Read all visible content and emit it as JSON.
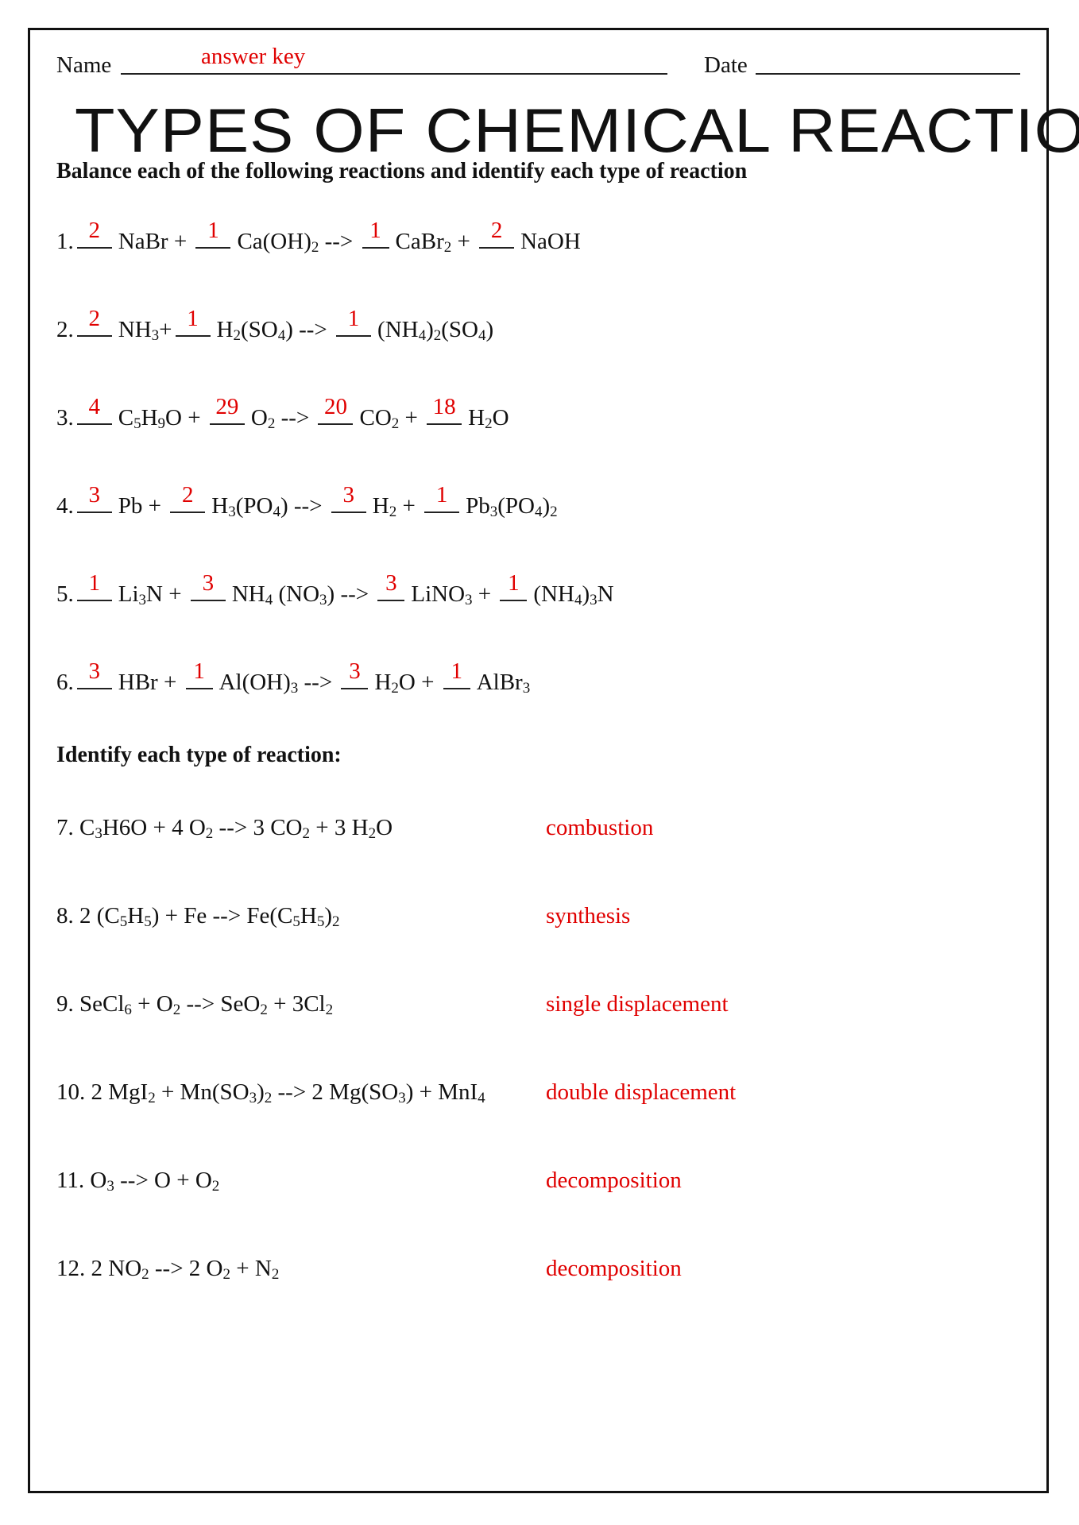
{
  "header": {
    "name_label": "Name",
    "name_value": "answer key",
    "date_label": "Date",
    "date_value": ""
  },
  "title": "TYPES OF CHEMICAL REACTIONS",
  "section1": {
    "instruction": "Balance each of the following reactions and identify each type of reaction",
    "problems": [
      {
        "number": "1.",
        "terms": [
          {
            "coef": "2",
            "formula": "NaBr",
            "blank": "w4"
          },
          {
            "op": "+"
          },
          {
            "coef": "1",
            "formula": "Ca(OH)_2",
            "blank": "w4"
          },
          {
            "op": "-->"
          },
          {
            "coef": "1",
            "formula": "CaBr_2",
            "blank": "w3"
          },
          {
            "op": "+"
          },
          {
            "coef": "2",
            "formula": "NaOH",
            "blank": "w4"
          }
        ]
      },
      {
        "number": "2.",
        "terms": [
          {
            "coef": "2",
            "formula": "NH_3+",
            "blank": "w4"
          },
          {
            "coef": "1",
            "formula": "H_2(SO_4)",
            "blank": "w4"
          },
          {
            "op": "-->"
          },
          {
            "coef": "1",
            "formula": "(NH_4)_2(SO_4)",
            "blank": "w4"
          }
        ]
      },
      {
        "number": "3.",
        "terms": [
          {
            "coef": "4",
            "formula": "C_5H_9O",
            "blank": "w4"
          },
          {
            "op": "+"
          },
          {
            "coef": "29",
            "formula": "O_2",
            "blank": "w4"
          },
          {
            "op": "-->"
          },
          {
            "coef": "20",
            "formula": "CO_2",
            "blank": "w4"
          },
          {
            "op": "+"
          },
          {
            "coef": "18",
            "formula": "H_2O",
            "blank": "w4"
          }
        ]
      },
      {
        "number": "4.",
        "terms": [
          {
            "coef": "3",
            "formula": "Pb",
            "blank": "w4"
          },
          {
            "op": "+"
          },
          {
            "coef": "2",
            "formula": "H_3(PO_4)",
            "blank": "w4"
          },
          {
            "op": "-->"
          },
          {
            "coef": "3",
            "formula": "H_2",
            "blank": "w4"
          },
          {
            "op": "+"
          },
          {
            "coef": "1",
            "formula": "Pb_3(PO_4)_2",
            "blank": "w4"
          }
        ]
      },
      {
        "number": "5.",
        "terms": [
          {
            "coef": "1",
            "formula": "Li_3N",
            "blank": "w4"
          },
          {
            "op": "+"
          },
          {
            "coef": "3",
            "formula": "NH_4 (NO_3)",
            "blank": "w4"
          },
          {
            "op": "-->"
          },
          {
            "coef": "3",
            "formula": "LiNO_3",
            "blank": "w3"
          },
          {
            "op": "+"
          },
          {
            "coef": "1",
            "formula": "(NH_4)_3N",
            "blank": "w3"
          }
        ]
      },
      {
        "number": "6.",
        "terms": [
          {
            "coef": "3",
            "formula": "HBr",
            "blank": "w4"
          },
          {
            "op": "+"
          },
          {
            "coef": "1",
            "formula": "Al(OH)_3",
            "blank": "w3"
          },
          {
            "op": "-->"
          },
          {
            "coef": "3",
            "formula": "H_2O",
            "blank": "w3"
          },
          {
            "op": "+"
          },
          {
            "coef": "1",
            "formula": "AlBr_3",
            "blank": "w3"
          }
        ]
      }
    ]
  },
  "section2": {
    "heading": "Identify each type of reaction:",
    "problems": [
      {
        "equation": "7. C_3H6O + 4 O_2 --> 3 CO_2 + 3 H_2O",
        "answer": "combustion"
      },
      {
        "equation": "8. 2 (C_5H_5) + Fe --> Fe(C_5H_5)_2",
        "answer": "synthesis"
      },
      {
        "equation": "9. SeCl_6 + O_2 --> SeO_2 + 3Cl_2",
        "answer": "single displacement"
      },
      {
        "equation": "10. 2 MgI_2 + Mn(SO_3)_2 --> 2 Mg(SO_3) + MnI_4",
        "answer": "double displacement"
      },
      {
        "equation": "11. O_3 --> O + O_2",
        "answer": "decomposition"
      },
      {
        "equation": "12. 2 NO_2 --> 2 O_2 + N_2",
        "answer": "decomposition"
      }
    ]
  },
  "colors": {
    "answer_red": "#e00000",
    "text": "#111111"
  }
}
